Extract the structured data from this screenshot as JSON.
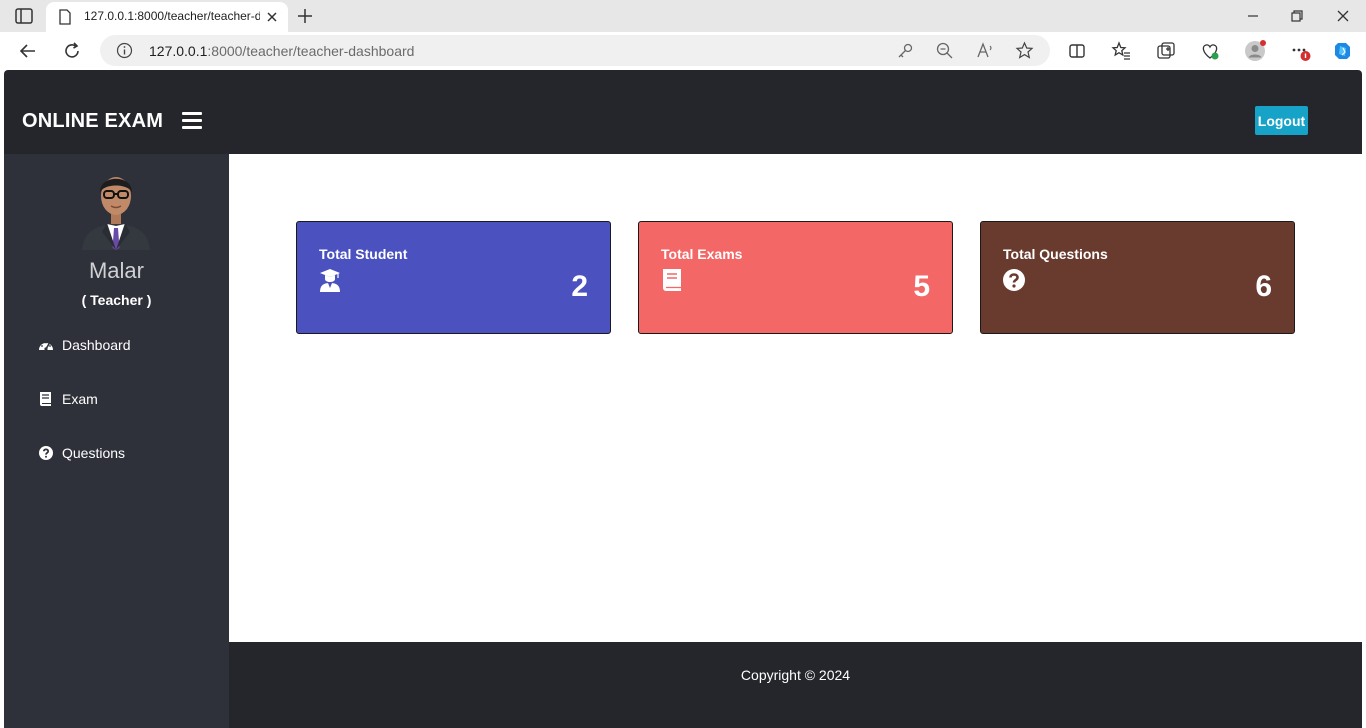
{
  "browser": {
    "tab_title": "127.0.0.1:8000/teacher/teacher-dashboard",
    "url_host": "127.0.0.1",
    "url_rest": ":8000/teacher/teacher-dashboard"
  },
  "app": {
    "brand": "ONLINE EXAM",
    "logout_label": "Logout"
  },
  "sidebar": {
    "user_name": "Malar",
    "user_role": "( Teacher )",
    "items": [
      {
        "label": "Dashboard",
        "icon": "tachometer-icon"
      },
      {
        "label": "Exam",
        "icon": "book-icon"
      },
      {
        "label": "Questions",
        "icon": "question-circle-icon"
      }
    ]
  },
  "cards": [
    {
      "title": "Total Student",
      "value": "2",
      "color": "#4b51bf",
      "icon": "graduate-icon"
    },
    {
      "title": "Total Exams",
      "value": "5",
      "color": "#f46767",
      "icon": "book-icon"
    },
    {
      "title": "Total Questions",
      "value": "6",
      "color": "#693b2f",
      "icon": "question-circle-icon"
    }
  ],
  "footer": {
    "text": "Copyright © 2024"
  },
  "colors": {
    "topbar": "#24262b",
    "sidebar": "#2e313a",
    "logout": "#17a2c8"
  }
}
